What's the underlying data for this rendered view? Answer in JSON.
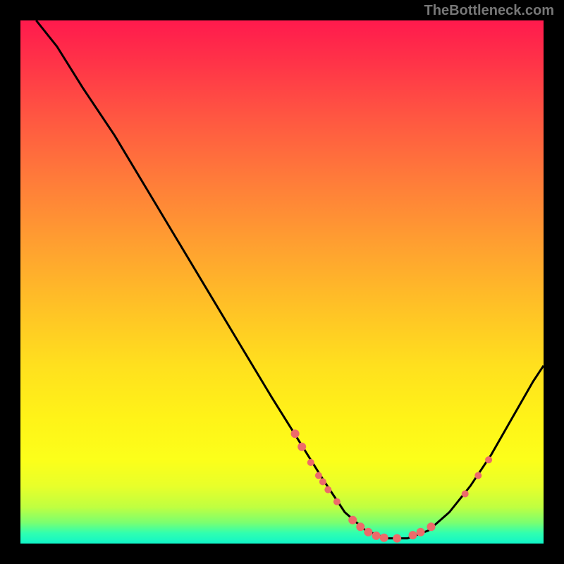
{
  "watermark": "TheBottleneck.com",
  "chart_data": {
    "type": "line",
    "title": "",
    "xlabel": "",
    "ylabel": "",
    "xlim": [
      0,
      100
    ],
    "ylim": [
      0,
      100
    ],
    "curve": [
      {
        "x": 3,
        "y": 100
      },
      {
        "x": 7,
        "y": 95
      },
      {
        "x": 12,
        "y": 87
      },
      {
        "x": 18,
        "y": 78
      },
      {
        "x": 24,
        "y": 68
      },
      {
        "x": 30,
        "y": 58
      },
      {
        "x": 36,
        "y": 48
      },
      {
        "x": 42,
        "y": 38
      },
      {
        "x": 48,
        "y": 28
      },
      {
        "x": 53,
        "y": 20
      },
      {
        "x": 58,
        "y": 12
      },
      {
        "x": 62,
        "y": 6
      },
      {
        "x": 66,
        "y": 2.5
      },
      {
        "x": 70,
        "y": 1
      },
      {
        "x": 74,
        "y": 1
      },
      {
        "x": 78,
        "y": 2.5
      },
      {
        "x": 82,
        "y": 6
      },
      {
        "x": 86,
        "y": 11
      },
      {
        "x": 90,
        "y": 17
      },
      {
        "x": 94,
        "y": 24
      },
      {
        "x": 98,
        "y": 31
      },
      {
        "x": 100,
        "y": 34
      }
    ],
    "markers": [
      {
        "x": 52.5,
        "y": 21,
        "r": 6
      },
      {
        "x": 53.8,
        "y": 18.5,
        "r": 6
      },
      {
        "x": 55.5,
        "y": 15.5,
        "r": 5
      },
      {
        "x": 57.0,
        "y": 13,
        "r": 5
      },
      {
        "x": 57.8,
        "y": 11.8,
        "r": 5
      },
      {
        "x": 58.8,
        "y": 10.3,
        "r": 5
      },
      {
        "x": 60.5,
        "y": 8,
        "r": 5
      },
      {
        "x": 63.5,
        "y": 4.5,
        "r": 6
      },
      {
        "x": 65.0,
        "y": 3.2,
        "r": 6
      },
      {
        "x": 66.5,
        "y": 2.2,
        "r": 6
      },
      {
        "x": 68.0,
        "y": 1.5,
        "r": 6
      },
      {
        "x": 69.5,
        "y": 1.1,
        "r": 6
      },
      {
        "x": 72.0,
        "y": 1.0,
        "r": 6
      },
      {
        "x": 75.0,
        "y": 1.6,
        "r": 6
      },
      {
        "x": 76.5,
        "y": 2.2,
        "r": 6
      },
      {
        "x": 78.5,
        "y": 3.2,
        "r": 6
      },
      {
        "x": 85.0,
        "y": 9.5,
        "r": 5
      },
      {
        "x": 87.5,
        "y": 13,
        "r": 5
      },
      {
        "x": 89.5,
        "y": 16,
        "r": 5
      }
    ],
    "marker_color": "#ed6a6a",
    "curve_color": "#000000"
  }
}
